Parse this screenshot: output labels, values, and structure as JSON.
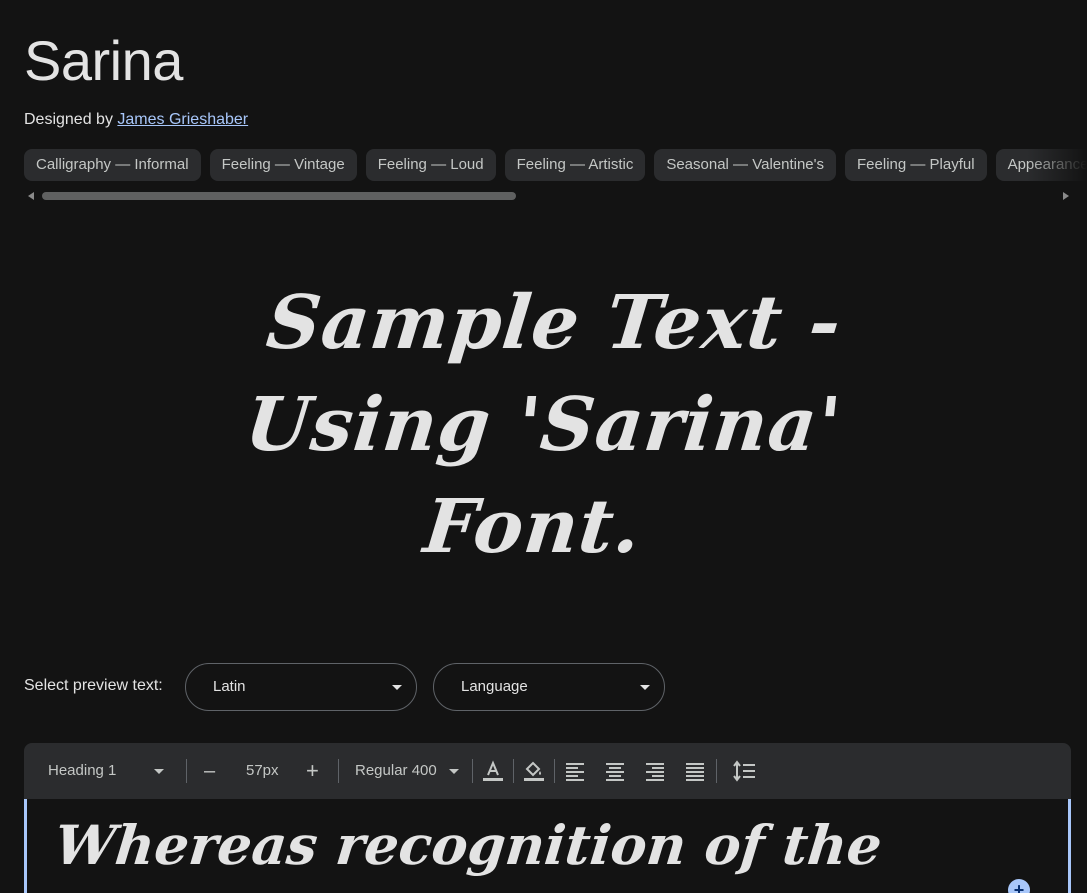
{
  "font": {
    "title": "Sarina",
    "designed_by_label": "Designed by",
    "designer": "James Grieshaber"
  },
  "tags": [
    "Calligraphy — Informal",
    "Feeling — Vintage",
    "Feeling — Loud",
    "Feeling — Artistic",
    "Seasonal — Valentine's",
    "Feeling — Playful",
    "Appearance"
  ],
  "preview": {
    "line1": "Sample Text -",
    "line2": "Using 'Sarina'",
    "line3": "Font."
  },
  "preview_select": {
    "label": "Select preview text:",
    "script": "Latin",
    "language": "Language"
  },
  "toolbar": {
    "style": "Heading 1",
    "decrease": "–",
    "size": "57px",
    "increase": "+",
    "weight": "Regular 400"
  },
  "editor": {
    "text": "Whereas recognition of the"
  },
  "icons": {
    "text_color": "text-color-icon",
    "highlight": "highlight-color-icon",
    "align_left": "align-left-icon",
    "align_center": "align-center-icon",
    "align_right": "align-right-icon",
    "align_justify": "align-justify-icon",
    "line_height": "line-height-icon",
    "add": "add-icon"
  },
  "colors": {
    "background": "#131313",
    "chip": "#2b2c2e",
    "link": "#a8c7fa",
    "text": "#e3e3e3"
  }
}
